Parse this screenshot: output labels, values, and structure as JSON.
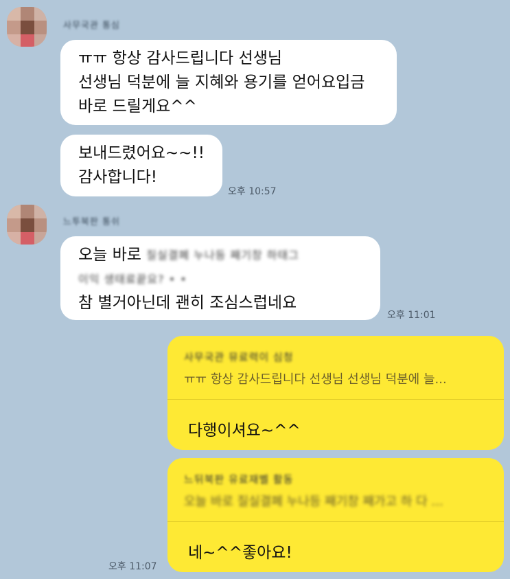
{
  "colors": {
    "background": "#b2c7d9",
    "incoming": "#ffffff",
    "outgoing": "#fee934"
  },
  "messages": {
    "group1": {
      "sender_name": "사무국관 통심",
      "bubble1_lines": [
        "ㅠㅠ 항상 감사드립니다 선생님",
        "선생님 덕분에 늘 지혜와 용기를 얻어요입금",
        "바로 드릴게요^^"
      ],
      "bubble2_lines": [
        "보내드렸어요~~!!",
        "감사합니다!"
      ],
      "time": "오후 10:57"
    },
    "group2": {
      "sender_name": "느투북판 통쉬",
      "line1_text": "오늘 바로",
      "line1_blurred": "질실결폐 누나등 째기창 하태그",
      "line2_blurred": "이익 생태료끝요? • •",
      "line3_text": "참 별거아닌데 괜히 조심스럽네요",
      "time": "오후 11:01"
    },
    "outgoing1": {
      "reply_name": "사무국관 뮤료력이 심청",
      "reply_preview": "ㅠㅠ 항상 감사드립니다 선생님 선생님 덕분에 늘...",
      "text": "다행이셔요~^^"
    },
    "outgoing2": {
      "reply_name": "느뒤북판 유료재벨 활동",
      "reply_preview": "오늘 바로 질실결폐 누나등 째기창 째가고 하 다 ...",
      "text": "네~^^좋아요!",
      "time": "오후 11:07"
    }
  }
}
